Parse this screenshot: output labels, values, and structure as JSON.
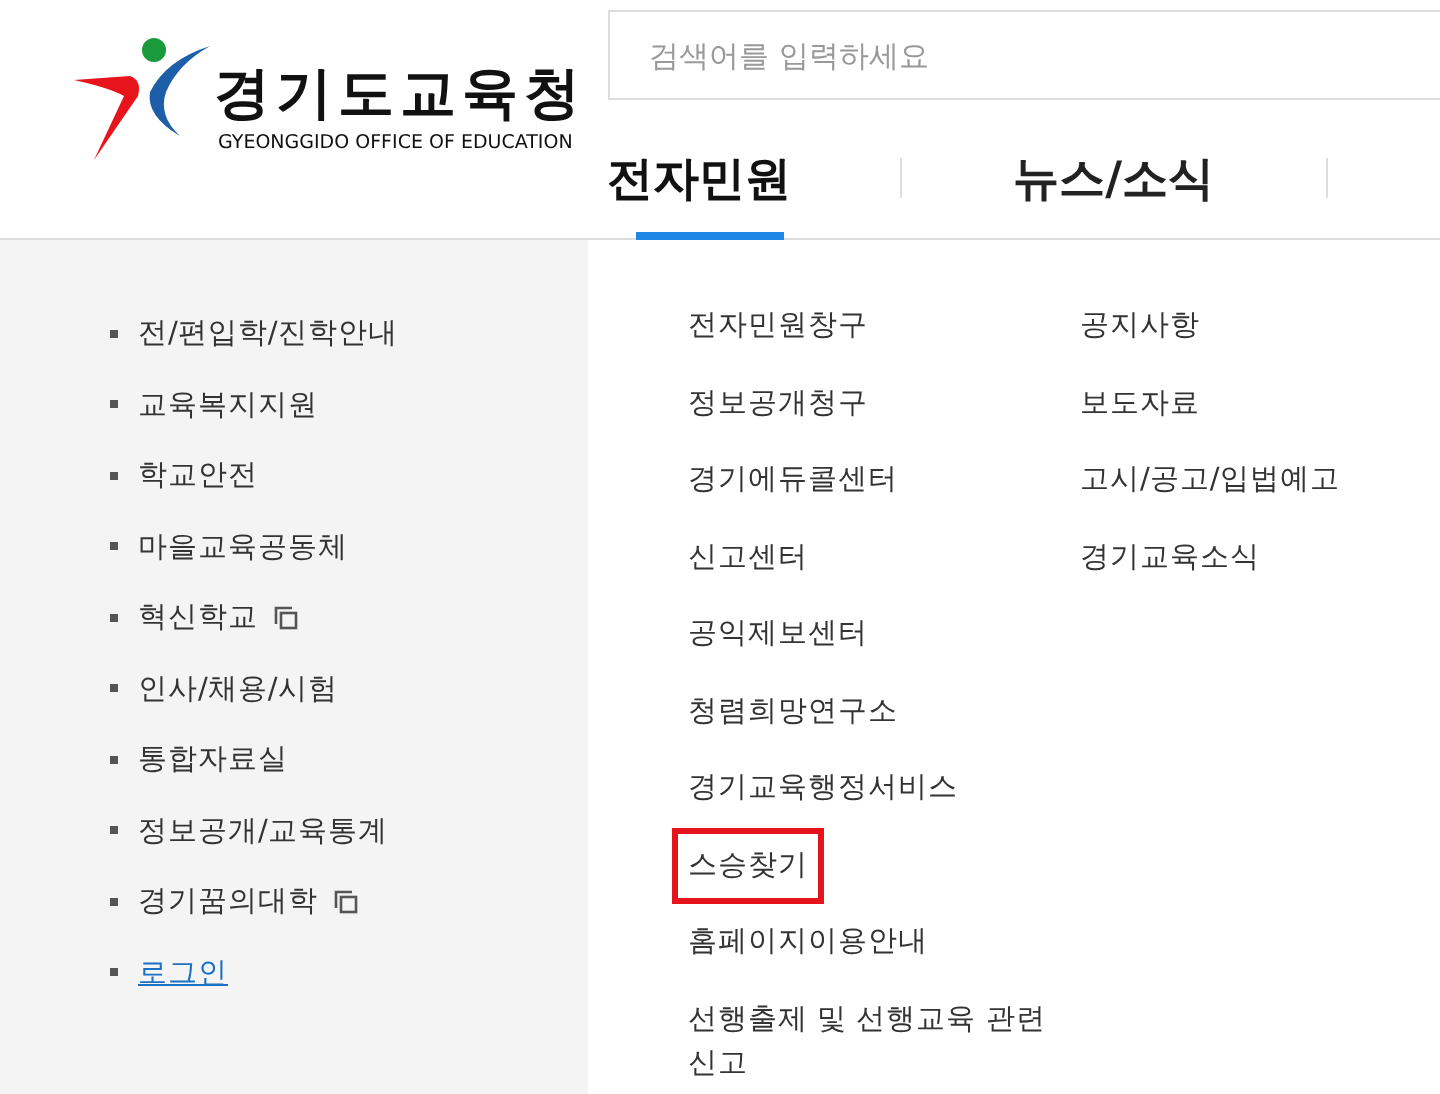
{
  "logo": {
    "title": "경기도교육청",
    "subtitle": "GYEONGGIDO OFFICE OF EDUCATION"
  },
  "search": {
    "placeholder": "검색어를 입력하세요"
  },
  "tabs": [
    {
      "label": "전자민원",
      "selected": true
    },
    {
      "label": "뉴스/소식",
      "selected": false
    }
  ],
  "sidebar": {
    "items": [
      {
        "label": "전/편입학/진학안내",
        "kind": "link"
      },
      {
        "label": "교육복지지원",
        "kind": "link"
      },
      {
        "label": "학교안전",
        "kind": "link"
      },
      {
        "label": "마을교육공동체",
        "kind": "link"
      },
      {
        "label": "혁신학교",
        "kind": "new-window"
      },
      {
        "label": "인사/채용/시험",
        "kind": "link"
      },
      {
        "label": "통합자료실",
        "kind": "link"
      },
      {
        "label": "정보공개/교육통계",
        "kind": "link"
      },
      {
        "label": "경기꿈의대학",
        "kind": "new-window"
      },
      {
        "label": "로그인",
        "kind": "login"
      }
    ]
  },
  "menu": {
    "columns": [
      [
        {
          "label": "전자민원창구",
          "highlighted": false
        },
        {
          "label": "정보공개청구",
          "highlighted": false
        },
        {
          "label": "경기에듀콜센터",
          "highlighted": false
        },
        {
          "label": "신고센터",
          "highlighted": false
        },
        {
          "label": "공익제보센터",
          "highlighted": false
        },
        {
          "label": "청렴희망연구소",
          "highlighted": false
        },
        {
          "label": "경기교육행정서비스",
          "highlighted": false
        },
        {
          "label": "스승찾기",
          "highlighted": true
        },
        {
          "label": "홈페이지이용안내",
          "highlighted": false
        },
        {
          "label": "선행출제 및 선행교육 관련 신고",
          "highlighted": false
        }
      ],
      [
        {
          "label": "공지사항",
          "highlighted": false
        },
        {
          "label": "보도자료",
          "highlighted": false
        },
        {
          "label": "고시/공고/입법예고",
          "highlighted": false
        },
        {
          "label": "경기교육소식",
          "highlighted": false
        }
      ]
    ]
  }
}
